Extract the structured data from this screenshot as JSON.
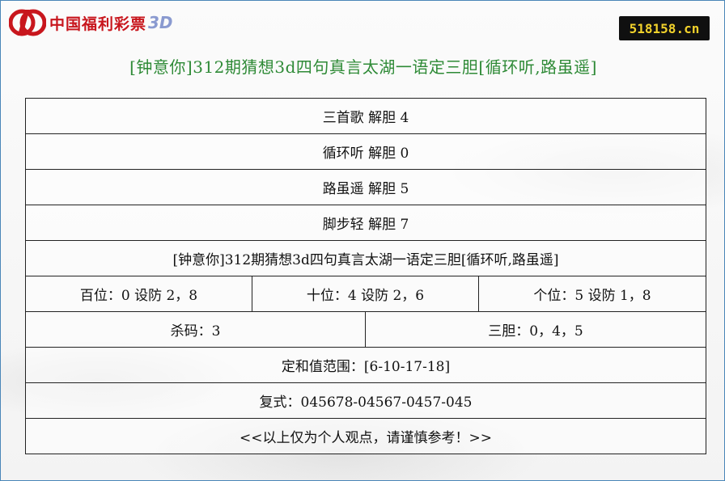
{
  "brand": {
    "logo_text": "中国福利彩票",
    "logo_suffix": "3D",
    "logo_color": "#c8161d"
  },
  "site_badge": "518158.cn",
  "title": "[钟意你]312期猜想3d四句真言太湖一语定三胆[循环听,路虽遥]",
  "rows": {
    "r1": "三首歌 解胆 4",
    "r2": "循环听 解胆 0",
    "r3": "路虽遥 解胆 5",
    "r4": "脚步轻 解胆 7",
    "r5": "[钟意你]312期猜想3d四句真言太湖一语定三胆[循环听,路虽遥]",
    "positions": {
      "hundreds": "百位：0 设防 2，8",
      "tens": "十位：4 设防 2，6",
      "units": "个位：5 设防 1，8"
    },
    "kill": "杀码：3",
    "three_bold": "三胆：0，4，5",
    "sum_range": "定和值范围：[6-10-17-18]",
    "compound": "复式：045678-04567-0457-045",
    "disclaimer": "<<以上仅为个人观点，请谨慎参考！>>"
  },
  "colors": {
    "title": "#2e8a36",
    "badge_bg": "#101010",
    "badge_text": "#f2d22b",
    "frame": "#4a86b8"
  }
}
